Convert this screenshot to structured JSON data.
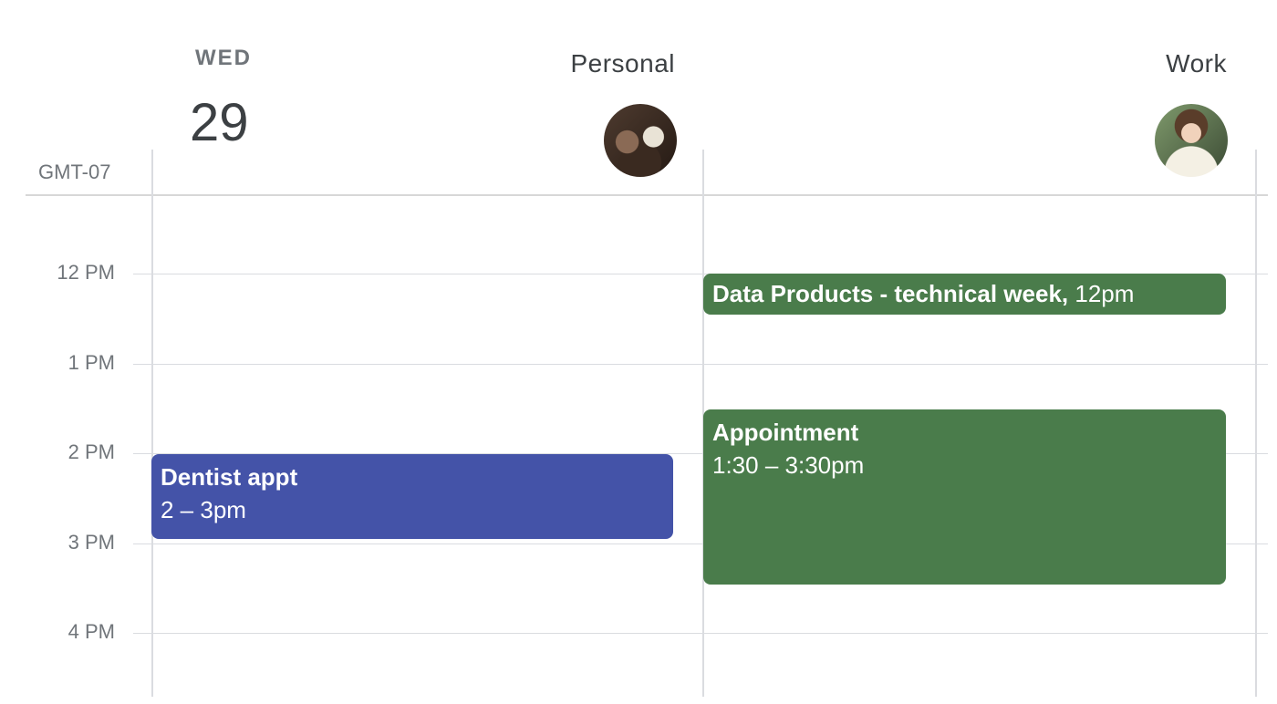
{
  "day": {
    "name": "WED",
    "number": "29"
  },
  "timezone": "GMT-07",
  "calendars": [
    {
      "label": "Personal",
      "avatar_icon": "personal-avatar"
    },
    {
      "label": "Work",
      "avatar_icon": "work-avatar"
    }
  ],
  "hours": [
    "12 PM",
    "1 PM",
    "2 PM",
    "3 PM",
    "4 PM"
  ],
  "events": {
    "dentist": {
      "title": "Dentist appt",
      "time": "2 – 3pm",
      "color": "#4453a8"
    },
    "data_products": {
      "title": "Data Products - technical week,",
      "time": "12pm",
      "color": "#4a7c4b"
    },
    "appointment": {
      "title": "Appointment",
      "time": "1:30 – 3:30pm",
      "color": "#4a7c4b"
    }
  }
}
